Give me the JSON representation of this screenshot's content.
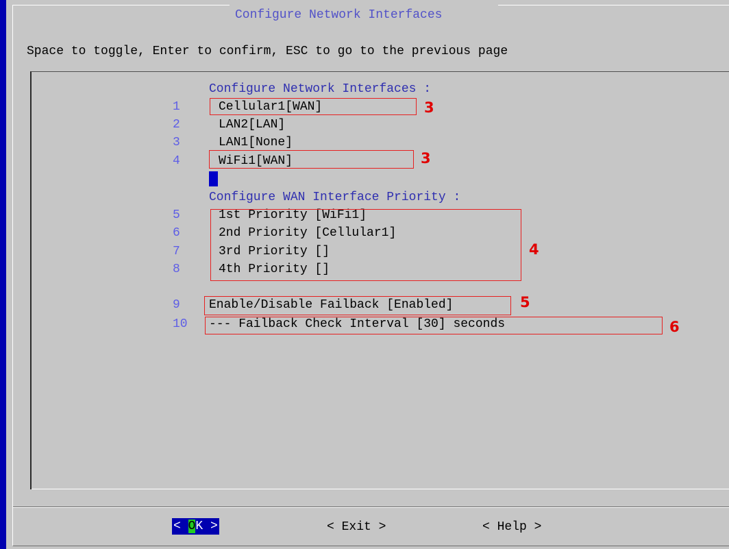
{
  "dialog": {
    "title": "Configure Network Interfaces",
    "instructions": "Space to toggle, Enter to confirm, ESC to go to the previous page"
  },
  "interfaces_section": {
    "header": "Configure Network Interfaces :",
    "items": [
      {
        "num": "1",
        "label": "Cellular1[WAN]"
      },
      {
        "num": "2",
        "label": "LAN2[LAN]"
      },
      {
        "num": "3",
        "label": "LAN1[None]"
      },
      {
        "num": "4",
        "label": "WiFi1[WAN]"
      }
    ]
  },
  "priority_section": {
    "header": "Configure WAN Interface Priority :",
    "items": [
      {
        "num": "5",
        "label": "1st Priority [WiFi1]"
      },
      {
        "num": "6",
        "label": "2nd Priority [Cellular1]"
      },
      {
        "num": "7",
        "label": "3rd Priority []"
      },
      {
        "num": "8",
        "label": "4th Priority []"
      }
    ]
  },
  "failback": {
    "toggle": {
      "num": "9",
      "label": "Enable/Disable Failback [Enabled]"
    },
    "interval": {
      "num": "10",
      "label": "--- Failback Check Interval [30] seconds"
    }
  },
  "annotations": {
    "cellular": "3",
    "wifi": "3",
    "priority": "4",
    "failback_toggle": "5",
    "failback_interval": "6"
  },
  "buttons": {
    "ok_left": "< ",
    "ok_hotkey": "O",
    "ok_rest": "K >",
    "exit": "< Exit >",
    "help": "< Help >"
  },
  "colors": {
    "background": "#c6c6c6",
    "accent_blue": "#0000b0",
    "annotation_red": "#e00000",
    "hotkey_green": "#22cc22"
  }
}
